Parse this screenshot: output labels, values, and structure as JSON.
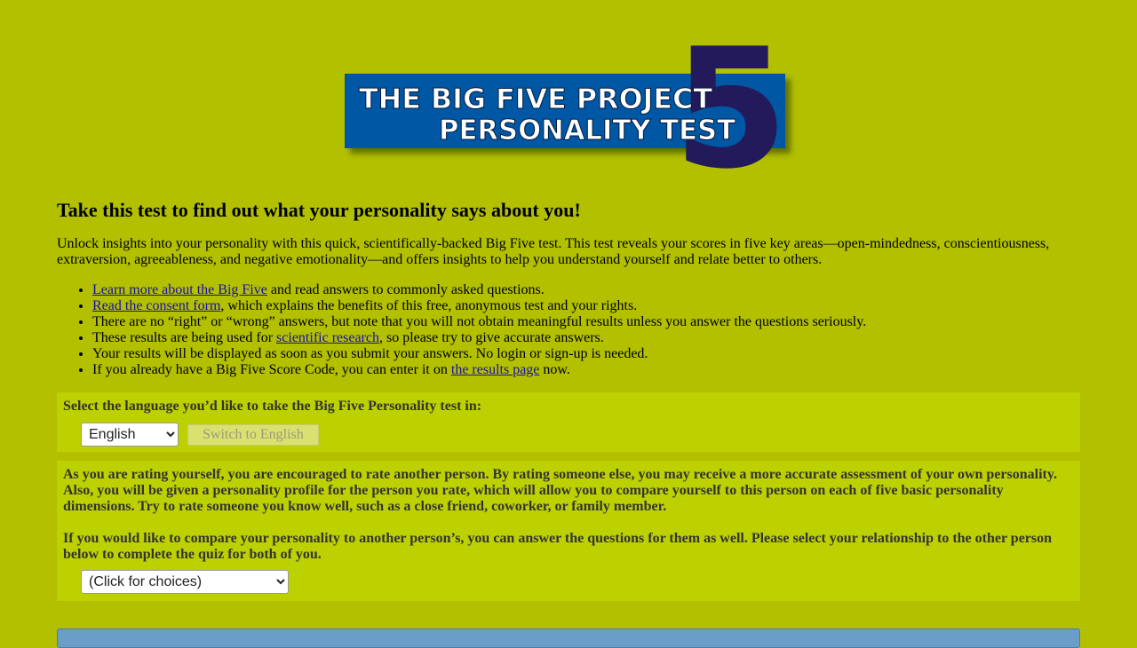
{
  "logo": {
    "line1": "THE BIG FIVE PROJECT",
    "line2": "PERSONALITY TEST",
    "numeral": "5",
    "colors": {
      "box": "#0057a4",
      "numeral": "#231a5c",
      "text": "#ffffff"
    }
  },
  "page": {
    "heading": "Take this test to find out what your personality says about you!",
    "intro": "Unlock insights into your personality with this quick, scientifically-backed Big Five test. This test reveals your scores in five key areas—open-mindedness, conscientiousness, extraversion, agreeableness, and negative emotionality—and offers insights to help you understand yourself and relate better to others."
  },
  "bullets": {
    "b1": {
      "link": "Learn more about the Big Five",
      "text": " and read answers to commonly asked questions."
    },
    "b2": {
      "link": "Read the consent form",
      "text": ", which explains the benefits of this free, anonymous test and your rights."
    },
    "b3": {
      "text": "There are no “right” or “wrong” answers, but note that you will not obtain meaningful results unless you answer the questions seriously."
    },
    "b4": {
      "before": "These results are being used for ",
      "link": "scientific research",
      "after": ", so please try to give accurate answers."
    },
    "b5": {
      "text": "Your results will be displayed as soon as you submit your answers. No login or sign-up is needed."
    },
    "b6": {
      "before": "If you already have a Big Five Score Code, you can enter it on ",
      "link": "the results page",
      "after": " now."
    }
  },
  "language": {
    "prompt": "Select the language you’d like to take the Big Five Personality test in:",
    "selected": "English",
    "switch_label": "Switch to English"
  },
  "rating": {
    "para1": "As you are rating yourself, you are encouraged to rate another person. By rating someone else, you may receive a more accurate assessment of your own personality. Also, you will be given a personality profile for the person you rate, which will allow you to compare yourself to this person on each of five basic personality dimensions. Try to rate someone you know well, such as a close friend, coworker, or family member.",
    "para2": "If you would like to compare your personality to another person’s, you can answer the questions for them as well. Please select your relationship to the other person below to complete the quiz for both of you.",
    "selected": "(Click for choices)"
  },
  "colors": {
    "background": "#b2c000",
    "panel": "#bdd000",
    "link": "#1a0dab",
    "bottom_bar": "#6a9ec8"
  }
}
